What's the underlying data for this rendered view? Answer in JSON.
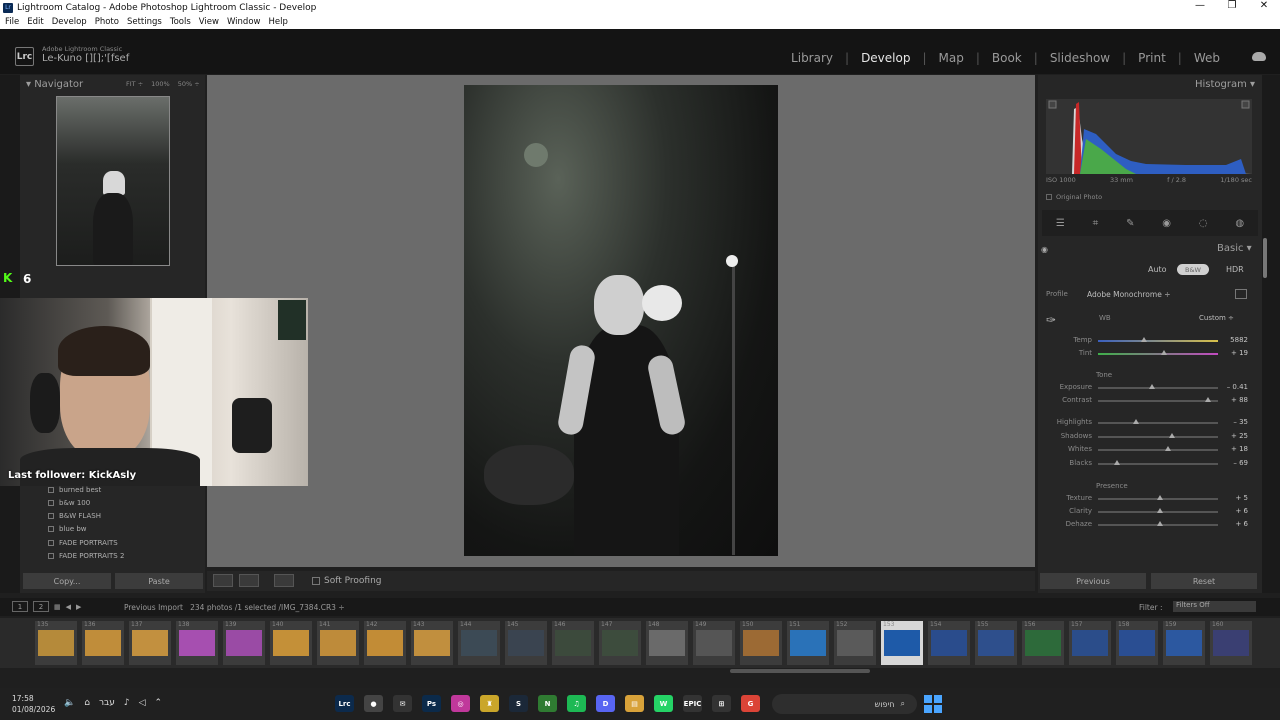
{
  "window": {
    "title": "Lightroom Catalog - Adobe Photoshop Lightroom Classic - Develop",
    "controls": [
      "—",
      "❐",
      "✕"
    ]
  },
  "menu": [
    "File",
    "Edit",
    "Develop",
    "Photo",
    "Settings",
    "Tools",
    "View",
    "Window",
    "Help"
  ],
  "header": {
    "logo": "Lrc",
    "brand_small": "Adobe Lightroom Classic",
    "identity": "Le-Kuno [][];'[fsef",
    "modules": [
      "Library",
      "Develop",
      "Map",
      "Book",
      "Slideshow",
      "Print",
      "Web"
    ],
    "active_module": "Develop"
  },
  "navigator": {
    "title": "Navigator",
    "zoom": [
      "FIT ÷",
      "100%",
      "50% ÷"
    ]
  },
  "overlay": {
    "kick_label": "K",
    "kick_count": "6",
    "follower": "Last follower: KickAsly"
  },
  "presets": [
    "burned best",
    "b&w 100",
    "B&W FLASH",
    "blue bw",
    "FADE PORTRAITS",
    "FADE PORTRAITS 2"
  ],
  "left_buttons": {
    "copy": "Copy...",
    "paste": "Paste"
  },
  "toolbar": {
    "soft_proofing": "Soft Proofing"
  },
  "histogram": {
    "title": "Histogram",
    "iso": "ISO 1000",
    "focal": "33 mm",
    "aperture": "f / 2.8",
    "shutter": "1/180 sec",
    "original_photo": "Original Photo"
  },
  "basic": {
    "title": "Basic",
    "auto": "Auto",
    "bw": "B&W",
    "hdr": "HDR",
    "profile_label": "Profile",
    "profile_value": "Adobe Monochrome ÷",
    "wb_label": "WB",
    "wb_value": "Custom ÷",
    "tone_label": "Tone",
    "presence_label": "Presence",
    "sliders": [
      {
        "label": "Temp",
        "value": "5882",
        "pos": 0.38
      },
      {
        "label": "Tint",
        "value": "+ 19",
        "pos": 0.55
      },
      {
        "label": "Exposure",
        "value": "– 0.41",
        "pos": 0.45
      },
      {
        "label": "Contrast",
        "value": "+ 88",
        "pos": 0.92
      },
      {
        "label": "Highlights",
        "value": "– 35",
        "pos": 0.32
      },
      {
        "label": "Shadows",
        "value": "+ 25",
        "pos": 0.62
      },
      {
        "label": "Whites",
        "value": "+ 18",
        "pos": 0.58
      },
      {
        "label": "Blacks",
        "value": "– 69",
        "pos": 0.16
      },
      {
        "label": "Texture",
        "value": "+ 5",
        "pos": 0.52
      },
      {
        "label": "Clarity",
        "value": "+ 6",
        "pos": 0.52
      },
      {
        "label": "Dehaze",
        "value": "+ 6",
        "pos": 0.52
      }
    ]
  },
  "right_buttons": {
    "previous": "Previous",
    "reset": "Reset"
  },
  "filmstrip": {
    "view_nums": [
      "1",
      "2"
    ],
    "source": "Previous Import",
    "info": "234 photos /1 selected /IMG_7384.CR3 ÷",
    "filter_label": "Filter :",
    "filter_value": "Filters Off",
    "thumbs": [
      {
        "n": "135",
        "color": "#b58a3a"
      },
      {
        "n": "136",
        "color": "#c08d3a"
      },
      {
        "n": "137",
        "color": "#c2903f"
      },
      {
        "n": "138",
        "color": "#a64fb0"
      },
      {
        "n": "139",
        "color": "#9a4ba5"
      },
      {
        "n": "140",
        "color": "#c49038"
      },
      {
        "n": "141",
        "color": "#be8b3a"
      },
      {
        "n": "142",
        "color": "#c28c36"
      },
      {
        "n": "143",
        "color": "#c18f3e"
      },
      {
        "n": "144",
        "color": "#3c4a55"
      },
      {
        "n": "145",
        "color": "#3a4450"
      },
      {
        "n": "146",
        "color": "#3c4a3c"
      },
      {
        "n": "147",
        "color": "#3d4c3d"
      },
      {
        "n": "148",
        "color": "#6a6a6a"
      },
      {
        "n": "149",
        "color": "#555555"
      },
      {
        "n": "150",
        "color": "#9c6a34"
      },
      {
        "n": "151",
        "color": "#2a72b8"
      },
      {
        "n": "152",
        "color": "#5a5a5a"
      },
      {
        "n": "153",
        "color": "#1e5aa8"
      },
      {
        "n": "154",
        "color": "#2a4c8c"
      },
      {
        "n": "155",
        "color": "#2e4f8c"
      },
      {
        "n": "156",
        "color": "#2d6a3a"
      },
      {
        "n": "157",
        "color": "#2b4d8a"
      },
      {
        "n": "158",
        "color": "#2a4e92"
      },
      {
        "n": "159",
        "color": "#2c58a0"
      },
      {
        "n": "160",
        "color": "#3a3f72"
      }
    ]
  },
  "taskbar": {
    "time": "17:58",
    "date": "01/08/2026",
    "lang": "עבר",
    "search": "חיפוש",
    "apps": [
      {
        "name": "Lrc",
        "color": "#0c2a4c"
      },
      {
        "name": "●",
        "color": "#444"
      },
      {
        "name": "✉",
        "color": "#333"
      },
      {
        "name": "Ps",
        "color": "#0b2a4a"
      },
      {
        "name": "◎",
        "color": "#c0389b"
      },
      {
        "name": "♜",
        "color": "#caa62a"
      },
      {
        "name": "S",
        "color": "#1b2838"
      },
      {
        "name": "N",
        "color": "#2f7b32"
      },
      {
        "name": "♫",
        "color": "#1db954"
      },
      {
        "name": "D",
        "color": "#5865f2"
      },
      {
        "name": "▤",
        "color": "#d8a23a"
      },
      {
        "name": "W",
        "color": "#25d366"
      },
      {
        "name": "EPIC",
        "color": "#333"
      },
      {
        "name": "⊞",
        "color": "#333"
      },
      {
        "name": "G",
        "color": "#db4437"
      }
    ]
  }
}
